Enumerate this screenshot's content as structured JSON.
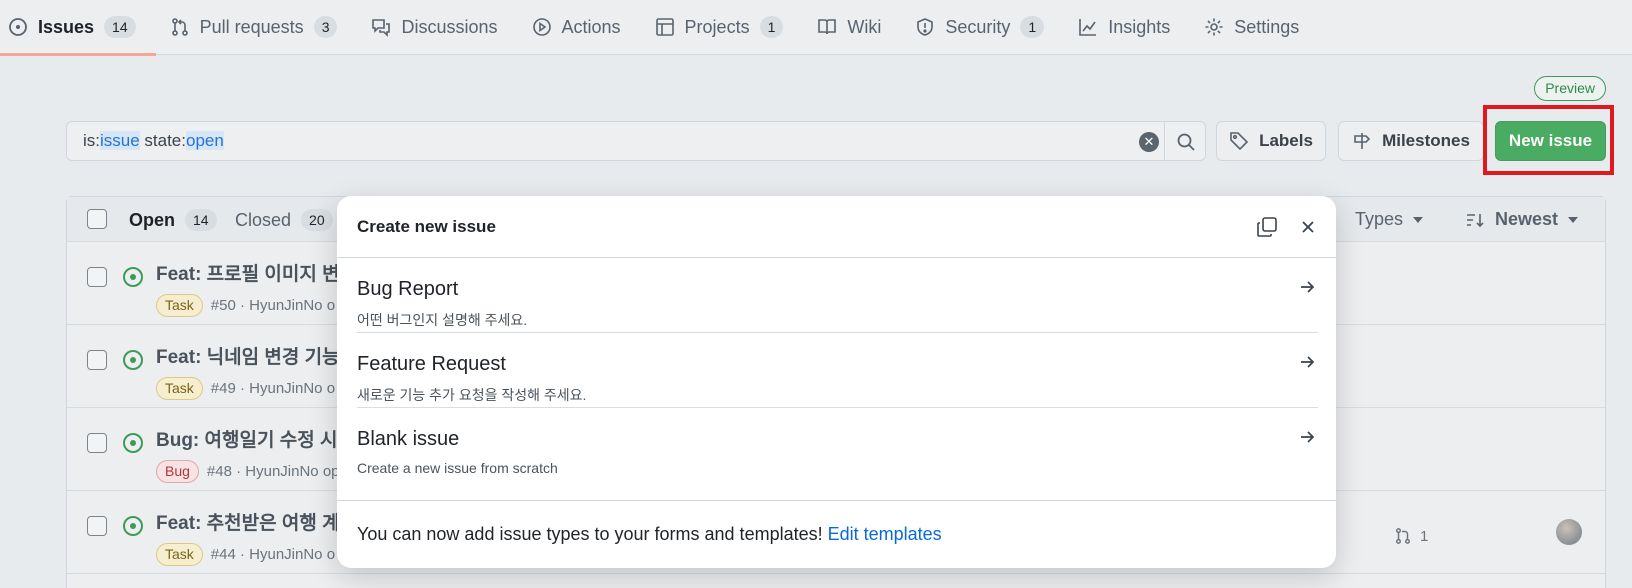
{
  "nav": {
    "items": [
      {
        "label": "Issues",
        "count": "14"
      },
      {
        "label": "Pull requests",
        "count": "3"
      },
      {
        "label": "Discussions"
      },
      {
        "label": "Actions"
      },
      {
        "label": "Projects",
        "count": "1"
      },
      {
        "label": "Wiki"
      },
      {
        "label": "Security",
        "count": "1"
      },
      {
        "label": "Insights"
      },
      {
        "label": "Settings"
      }
    ]
  },
  "preview_badge": "Preview",
  "search": {
    "prefix1": "is:",
    "value1": "issue",
    "prefix2": " state:",
    "value2": "open"
  },
  "toolbar": {
    "labels": "Labels",
    "milestones": "Milestones",
    "new_issue": "New issue"
  },
  "list_header": {
    "open_label": "Open",
    "open_count": "14",
    "closed_label": "Closed",
    "closed_count": "20",
    "types_label": "Types",
    "sort_label": "Newest"
  },
  "issues": [
    {
      "title": "Feat: 프로필 이미지 변",
      "type": "Task",
      "meta": "#50 · HyunJinNo o"
    },
    {
      "title": "Feat: 닉네임 변경 기능",
      "type": "Task",
      "meta": "#49 · HyunJinNo o"
    },
    {
      "title": "Bug: 여행일기 수정 시",
      "type": "Bug",
      "meta": "#48 · HyunJinNo op"
    },
    {
      "title": "Feat: 추천받은 여행 계",
      "type": "Task",
      "meta": "#44 · HyunJinNo o",
      "pr_count": "1"
    }
  ],
  "modal": {
    "title": "Create new issue",
    "options": [
      {
        "title": "Bug Report",
        "desc": "어떤 버그인지 설명해 주세요."
      },
      {
        "title": "Feature Request",
        "desc": "새로운 기능 추가 요청을 작성해 주세요."
      },
      {
        "title": "Blank issue",
        "desc": "Create a new issue from scratch"
      }
    ],
    "footer_text": "You can now add issue types to your forms and templates! ",
    "footer_link": "Edit templates"
  },
  "colors": {
    "accent_green": "#2fa04a",
    "highlight_red": "#e0191e",
    "link_blue": "#0969da"
  }
}
